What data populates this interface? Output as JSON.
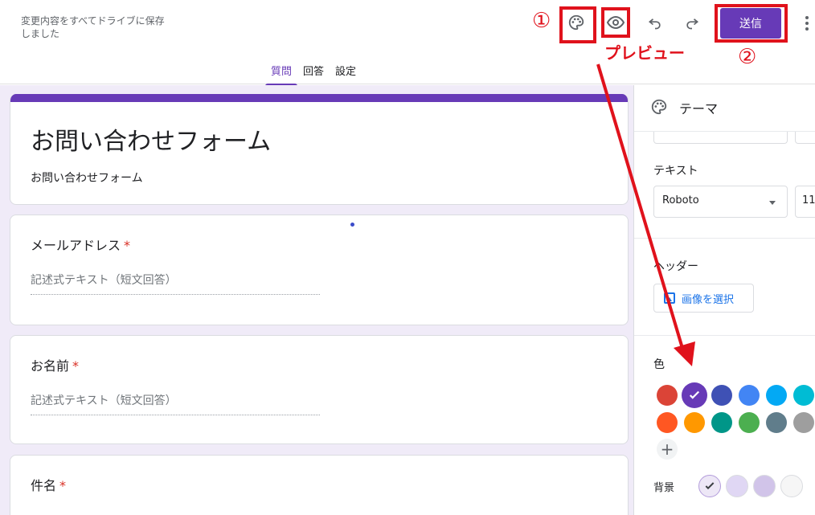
{
  "header": {
    "save_status": "変更内容をすべてドライブに保存しました",
    "send_label": "送信",
    "tabs": [
      {
        "label": "質問",
        "active": true
      },
      {
        "label": "回答",
        "active": false
      },
      {
        "label": "設定",
        "active": false
      }
    ],
    "icons": [
      "palette-icon",
      "eye-icon",
      "undo-icon",
      "redo-icon",
      "more-vert-icon"
    ]
  },
  "annotations": {
    "num1": "①",
    "num2": "②",
    "preview_label": "プレビュー",
    "color": "#e0121c"
  },
  "form": {
    "title": "お問い合わせフォーム",
    "description": "お問い合わせフォーム",
    "questions": [
      {
        "title": "メールアドレス",
        "required": "*",
        "placeholder": "記述式テキスト（短文回答）"
      },
      {
        "title": "お名前",
        "required": "*",
        "placeholder": "記述式テキスト（短文回答）"
      },
      {
        "title": "件名",
        "required": "*"
      }
    ]
  },
  "theme_panel": {
    "title": "テーマ",
    "text_label": "テキスト",
    "font": "Roboto",
    "font_size": "11",
    "header_label": "ヘッダー",
    "image_button": "画像を選択",
    "color_label": "色",
    "background_label": "背景",
    "colors": [
      "#db4437",
      "#673ab7",
      "#3f51b5",
      "#4285f4",
      "#03a9f4",
      "#00bcd4",
      "#ff5722",
      "#ff9800",
      "#009688",
      "#4caf50",
      "#607d8b",
      "#9e9e9e"
    ],
    "selected_color": "#673ab7",
    "backgrounds": [
      "#ede7f6",
      "#e0d7f4",
      "#d1c4e9",
      "#f6f6f6"
    ]
  },
  "theme": {
    "accent": "#673ab7",
    "page_bg": "#f0ebf8"
  }
}
